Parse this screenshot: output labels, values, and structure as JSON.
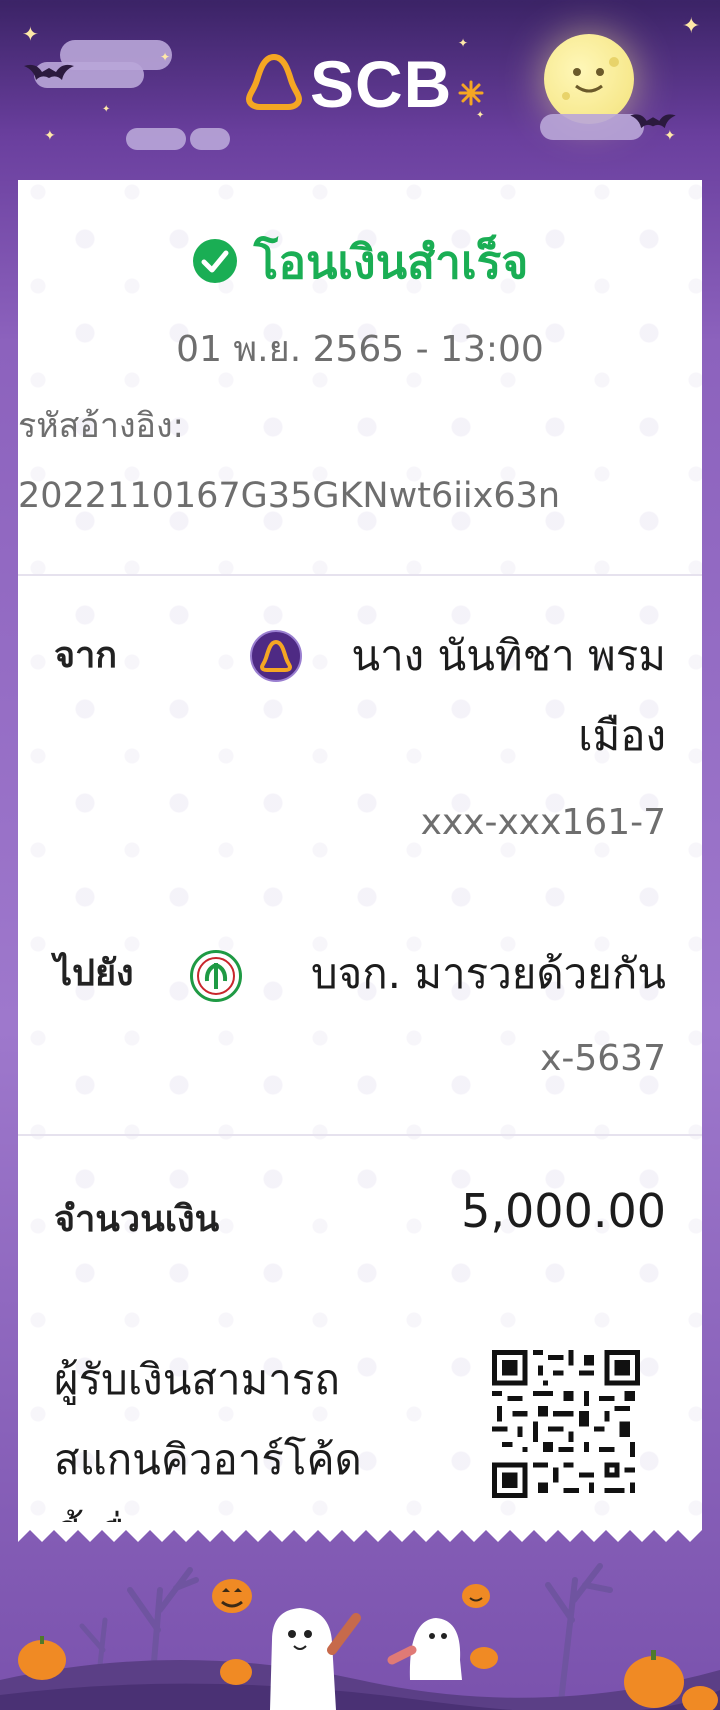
{
  "header": {
    "brand": "SCB",
    "accent_color": "#f5a623",
    "icons": [
      "scb-logo-icon",
      "moon-icon",
      "bat-icon",
      "star-icon",
      "cloud-icon"
    ]
  },
  "receipt": {
    "status": "โอนเงินสำเร็จ",
    "status_color": "#1aae54",
    "datetime": "01 พ.ย. 2565 - 13:00",
    "ref_label": "รหัสอ้างอิง:",
    "ref_value": "2022110167G35GKNwt6iix63n",
    "from": {
      "label": "จาก",
      "name_line1": "นาง นันทิชา พรม",
      "name_line2": "เมือง",
      "account": "xxx-xxx161-7",
      "bank_icon": "scb-bank-icon"
    },
    "to": {
      "label": "ไปยัง",
      "name": "บจก. มารวยด้วยกัน",
      "account": "x-5637",
      "bank_icon": "kbank-icon"
    },
    "amount_label": "จำนวนเงิน",
    "amount": "5,000.00",
    "qr_note_line1": "ผู้รับเงินสามารถ",
    "qr_note_line2": "สแกนคิวอาร์โค้ด",
    "qr_note_line3": "นี้เพื่อ",
    "qr_icon": "qr-code-icon"
  },
  "footer": {
    "scene": "halloween-ghosts-pumpkins"
  }
}
